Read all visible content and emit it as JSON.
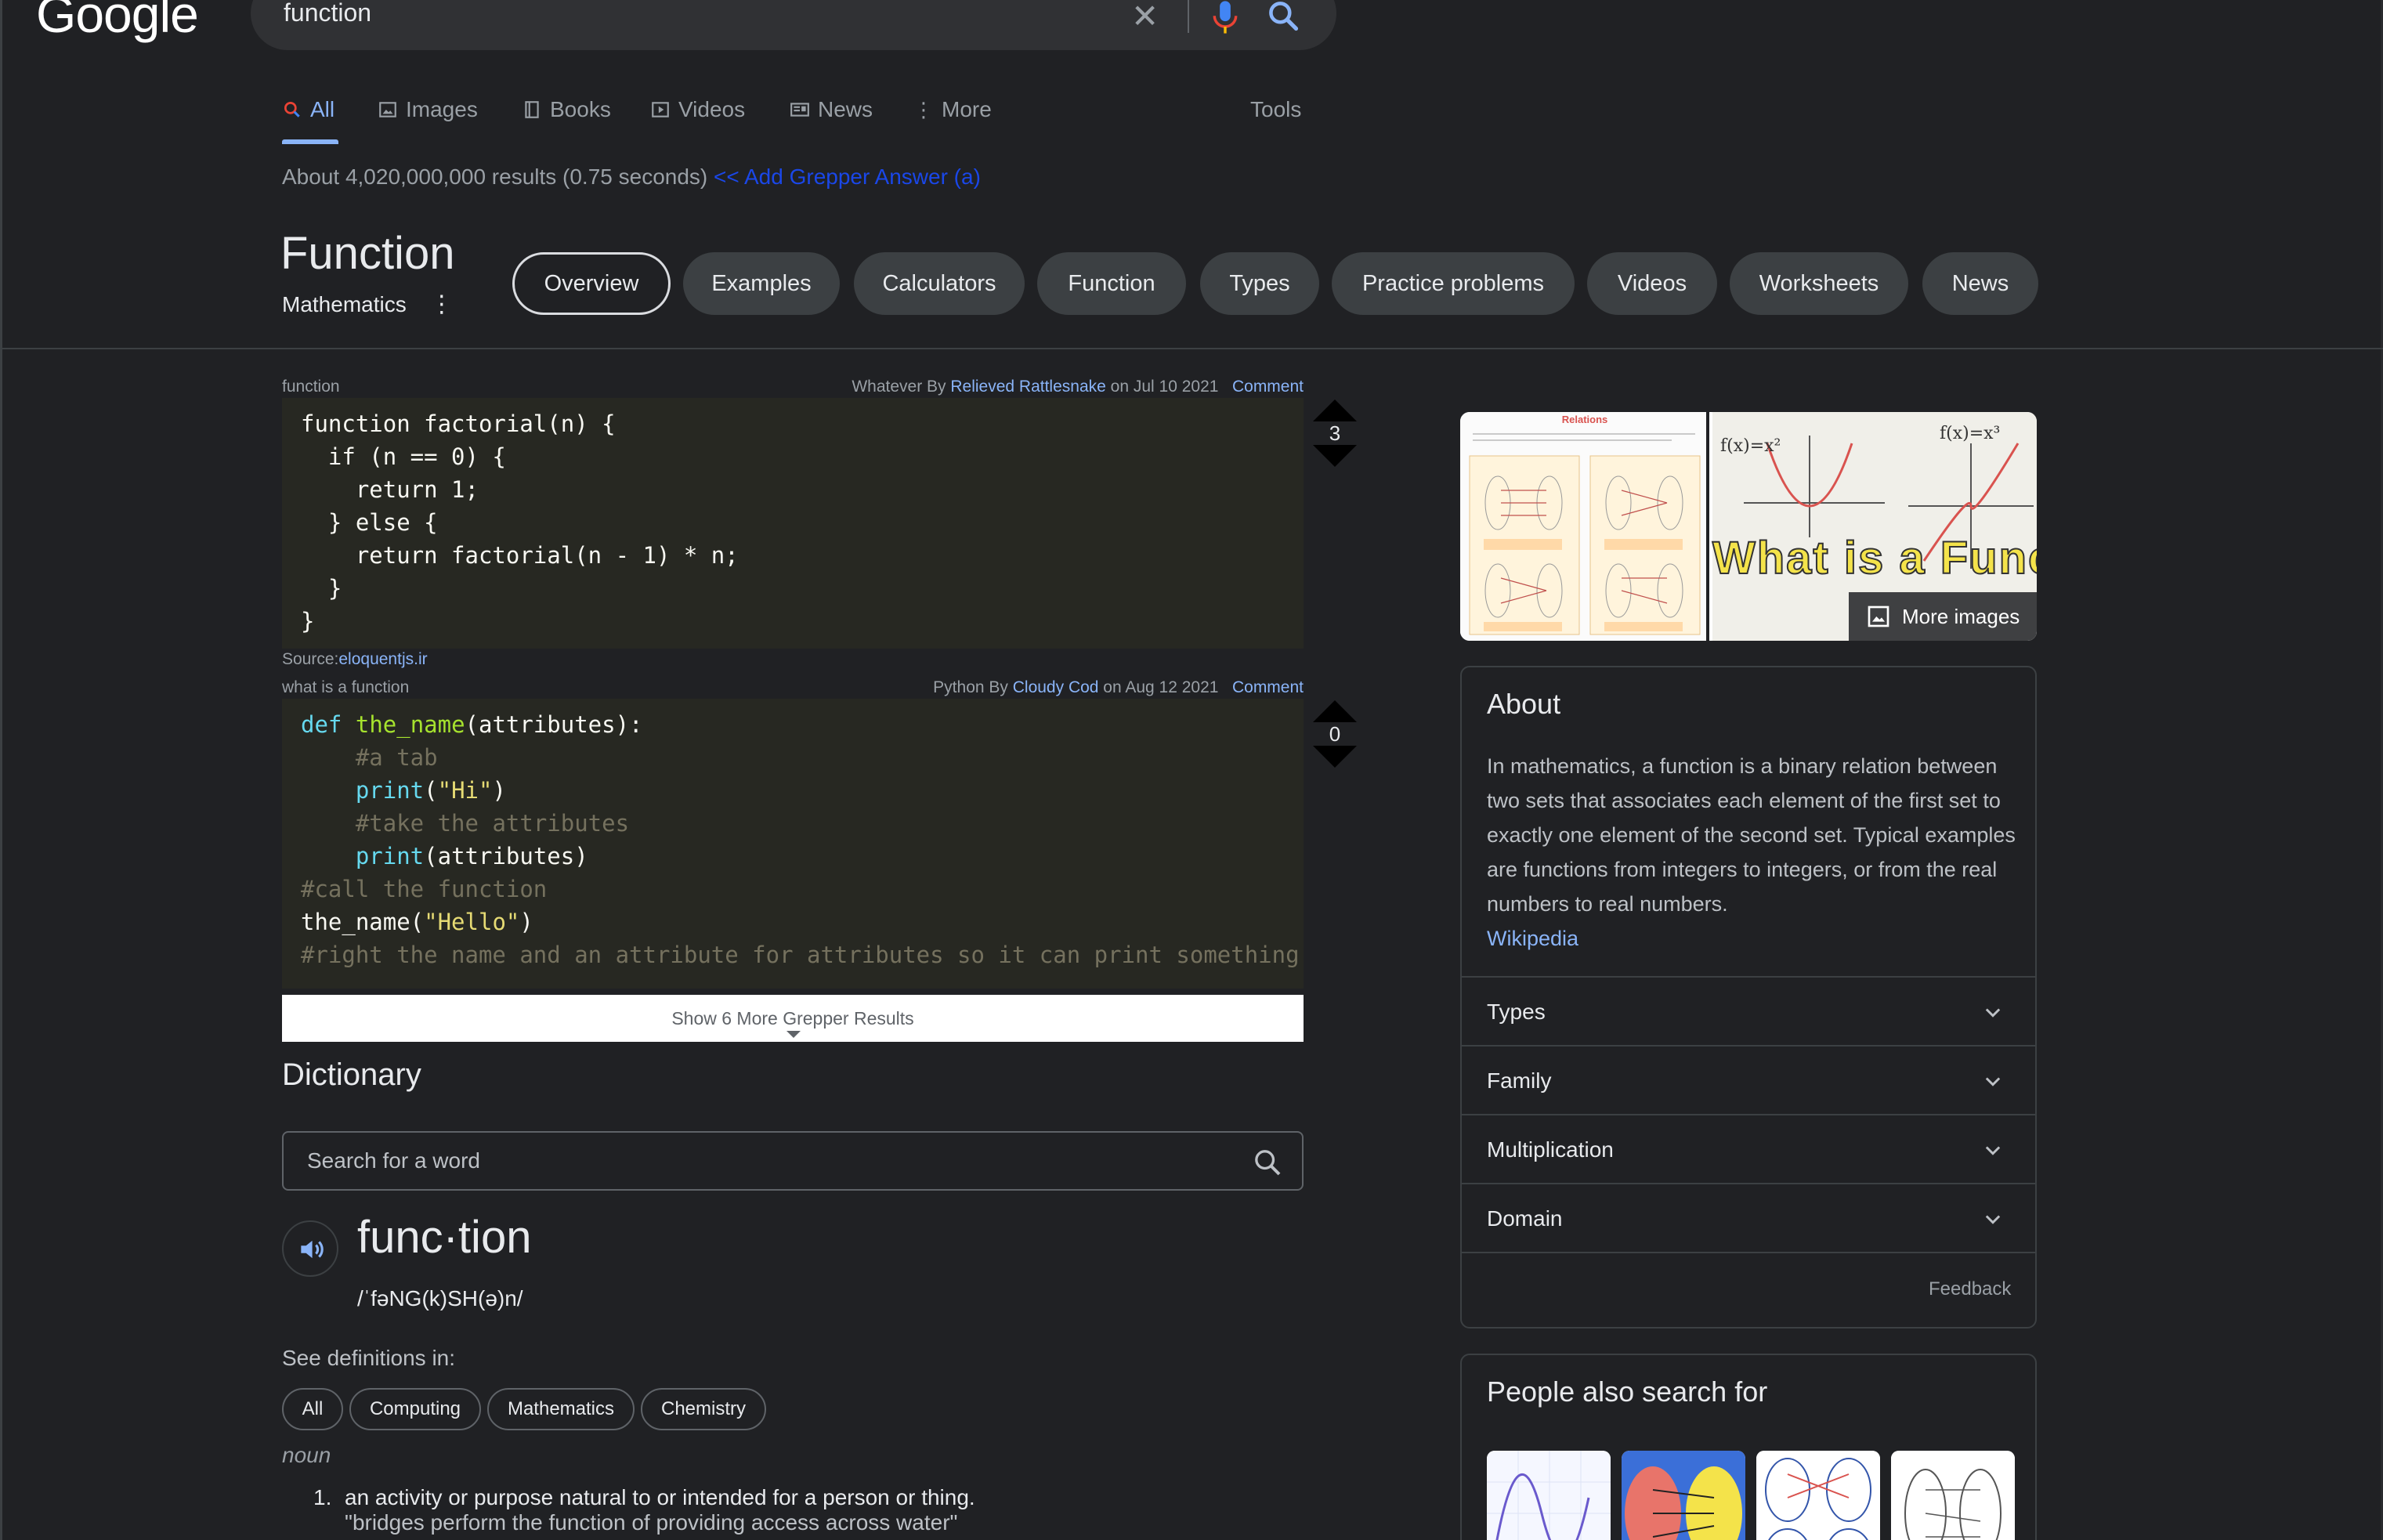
{
  "header": {
    "logo": "Google",
    "query": "function"
  },
  "tabs": [
    {
      "label": "All",
      "icon": "search-icon"
    },
    {
      "label": "Images",
      "icon": "image-icon"
    },
    {
      "label": "Books",
      "icon": "book-icon"
    },
    {
      "label": "Videos",
      "icon": "video-icon"
    },
    {
      "label": "News",
      "icon": "news-icon"
    },
    {
      "label": "More",
      "icon": "kebab-icon"
    },
    {
      "label": "Tools",
      "icon": ""
    }
  ],
  "results": {
    "count_text": "About 4,020,000,000 results (0.75 seconds)",
    "grepper_link": "<< Add Grepper Answer (a)"
  },
  "knowledge": {
    "title": "Function",
    "subtitle": "Mathematics",
    "chips": [
      "Overview",
      "Examples",
      "Calculators",
      "Function",
      "Types",
      "Practice problems",
      "Videos",
      "Worksheets",
      "News"
    ]
  },
  "grepper": {
    "answers": [
      {
        "query": "function",
        "lang_prefix": "Whatever By ",
        "author": "Relieved Rattlesnake",
        "date": " on Jul 10 2021",
        "comment": "Comment",
        "votes": "3",
        "source_label": "Source:",
        "source": "eloquentjs.ir"
      },
      {
        "query": "what is a function",
        "lang_prefix": "Python By ",
        "author": "Cloudy Cod",
        "date": " on Aug 12 2021",
        "comment": "Comment",
        "votes": "0"
      }
    ],
    "show_more": "Show 6 More Grepper Results"
  },
  "dictionary": {
    "title": "Dictionary",
    "search_placeholder": "Search for a word",
    "word": "func·tion",
    "phonetic": "/ˈfəNG(k)SH(ə)n/",
    "see_definitions": "See definitions in:",
    "chips": [
      "All",
      "Computing",
      "Mathematics",
      "Chemistry"
    ],
    "pos": "noun",
    "definitions": [
      {
        "num": "1.",
        "text": "an activity or purpose natural to or intended for a person or thing.",
        "example": "\"bridges perform the function of providing access across water\""
      }
    ]
  },
  "panel": {
    "more_images": "More images",
    "thumb_left_title": "Relations",
    "thumb_right_text": "What is a Function?",
    "about_title": "About",
    "about_text": "In mathematics, a function is a binary relation between two sets that associates each element of the first set to exactly one element of the second set. Typical examples are functions from integers to integers, or from the real numbers to real numbers.",
    "about_source": "Wikipedia",
    "accordion": [
      "Types",
      "Family",
      "Multiplication",
      "Domain"
    ],
    "feedback": "Feedback",
    "people_also_search": "People also search for"
  },
  "colors": {
    "background": "#202124",
    "link": "#8ab4f8",
    "grepper_link": "#1a47e8",
    "code_bg": "#272822"
  }
}
